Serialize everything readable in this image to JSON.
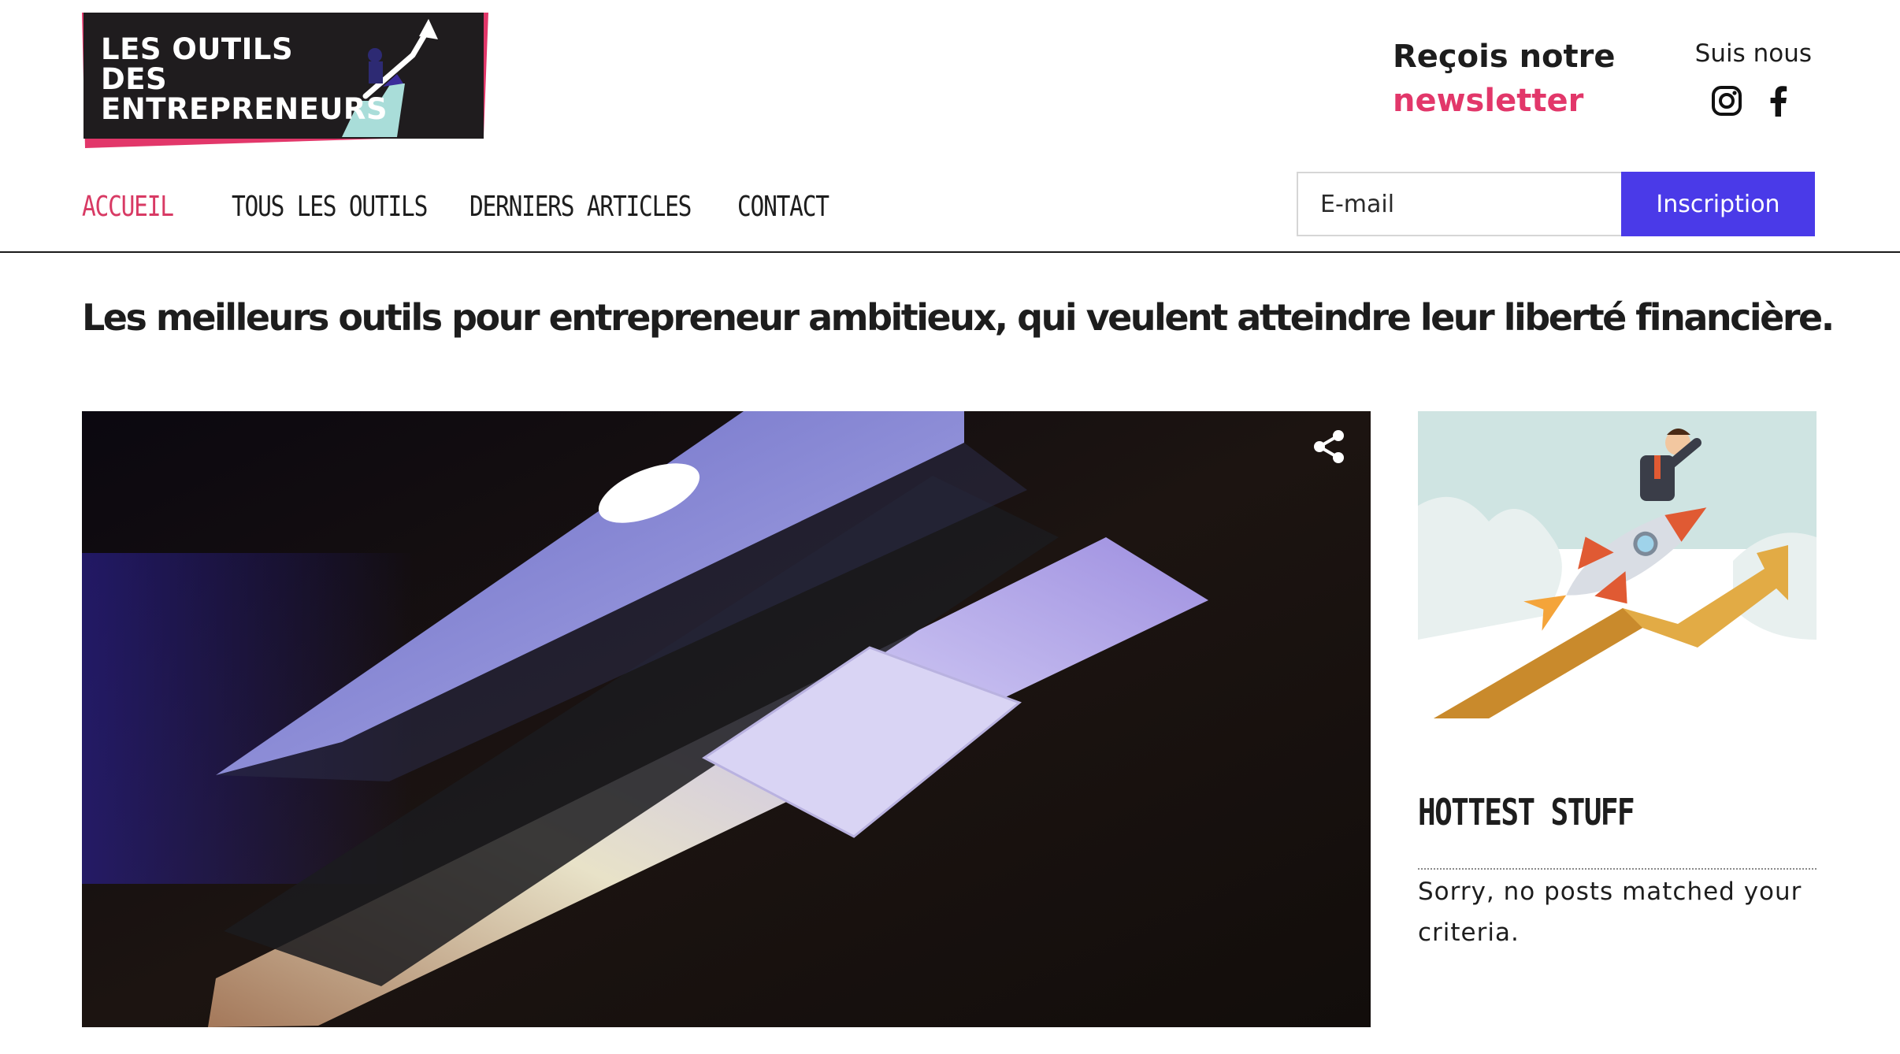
{
  "header": {
    "logo_text": "LES OUTILS DES\nENTREPRENEURS",
    "newsletter_title": "Reçois notre",
    "newsletter_accent": "newsletter",
    "follow_label": "Suis nous",
    "social_icons": [
      "instagram-icon",
      "facebook-icon"
    ]
  },
  "nav": {
    "items": [
      {
        "label": "ACCUEIL",
        "active": true
      },
      {
        "label": "TOUS LES OUTILS",
        "active": false
      },
      {
        "label": "DERNIERS ARTICLES",
        "active": false
      },
      {
        "label": "CONTACT",
        "active": false
      }
    ]
  },
  "signup": {
    "placeholder": "E-mail",
    "value": "",
    "button_label": "Inscription"
  },
  "main": {
    "tagline": "Les meilleurs outils pour entrepreneur ambitieux, qui veulent atteindre leur liberté financière.",
    "hero_icon": "share-icon"
  },
  "sidebar": {
    "title": "HOTTEST STUFF",
    "empty_message": "Sorry, no posts matched your criteria."
  },
  "colors": {
    "accent_pink": "#e2376a",
    "active_nav": "#d83a64",
    "button_blue": "#4a3ae8",
    "logo_bg": "#1f1c1e"
  }
}
